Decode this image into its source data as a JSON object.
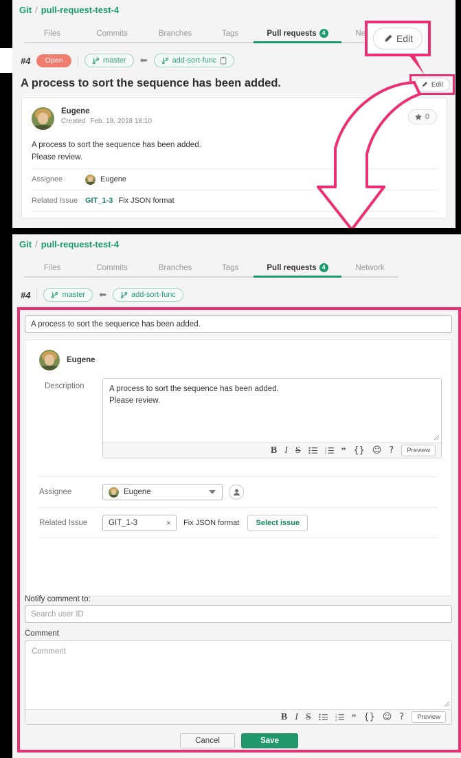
{
  "colors": {
    "accent_green": "#1a9a6b",
    "highlight_pink": "#ec2f72",
    "open_badge": "#ef7d70",
    "save_green": "#22996d",
    "page_bg": "#f4f4f4"
  },
  "top_panel": {
    "breadcrumb": {
      "root": "Git",
      "separator": "/",
      "repo": "pull-request-test-4"
    },
    "tabs": [
      {
        "label": "Files",
        "active": false,
        "count": ""
      },
      {
        "label": "Commits",
        "active": false,
        "count": ""
      },
      {
        "label": "Branches",
        "active": false,
        "count": ""
      },
      {
        "label": "Tags",
        "active": false,
        "count": ""
      },
      {
        "label": "Pull requests",
        "active": true,
        "count": "4"
      },
      {
        "label": "Network",
        "active": false,
        "count": ""
      }
    ],
    "pr_number": "#4",
    "status_badge": "Open",
    "base_branch": "master",
    "compare_branch": "add-sort-func",
    "copy_icon": "clipboard-icon",
    "title": "A process to sort the sequence has been added.",
    "edit_button_label": "Edit",
    "edit_icon": "pencil-icon",
    "comment": {
      "author": "Eugene",
      "created_label": "Created",
      "created_at": "Feb. 19, 2018 18:10",
      "body_line1": "A process to sort the sequence has been added.",
      "body_line2": "Please review."
    },
    "star": {
      "icon": "star-icon",
      "count": "0"
    },
    "meta_rows": [
      {
        "label": "Assignee",
        "value": "Eugene",
        "has_avatar": true,
        "link": "",
        "extra": ""
      },
      {
        "label": "Related Issue",
        "value": "",
        "has_avatar": false,
        "link": "GIT_1-3",
        "extra": "Fix JSON format"
      }
    ]
  },
  "callout": {
    "magnified_edit_label": "Edit",
    "magnified_edit_icon": "pencil-icon",
    "arrow_icon": "curved-down-arrow"
  },
  "bottom_panel": {
    "breadcrumb": {
      "root": "Git",
      "separator": "/",
      "repo": "pull-request-test-4"
    },
    "tabs": [
      {
        "label": "Files",
        "active": false,
        "count": ""
      },
      {
        "label": "Commits",
        "active": false,
        "count": ""
      },
      {
        "label": "Branches",
        "active": false,
        "count": ""
      },
      {
        "label": "Tags",
        "active": false,
        "count": ""
      },
      {
        "label": "Pull requests",
        "active": true,
        "count": "4"
      },
      {
        "label": "Network",
        "active": false,
        "count": ""
      }
    ],
    "pr_number": "#4",
    "base_branch": "master",
    "compare_branch": "add-sort-func",
    "title_input_value": "A process to sort the sequence has been added.",
    "author": "Eugene",
    "description_label": "Description",
    "description_line1": "A process to sort the sequence has been added.",
    "description_line2": "Please review.",
    "toolbar": {
      "bold": "B",
      "italic": "I",
      "strike": "S",
      "bullet_list": "bullet-list-icon",
      "numbered_list": "numbered-list-icon",
      "quote": "”",
      "code": "{}",
      "emoji": "☺",
      "help": "?",
      "preview_label": "Preview"
    },
    "assignee_label": "Assignee",
    "assignee_value": "Eugene",
    "assign_self_icon": "user-icon",
    "related_issue_label": "Related Issue",
    "related_issue_value": "GIT_1-3",
    "related_issue_clear": "×",
    "related_issue_title": "Fix JSON format",
    "select_issue_label": "Select issue",
    "notify_label": "Notify comment to:",
    "notify_placeholder": "Search user ID",
    "comment_label": "Comment",
    "comment_placeholder": "Comment",
    "cancel_label": "Cancel",
    "save_label": "Save"
  }
}
